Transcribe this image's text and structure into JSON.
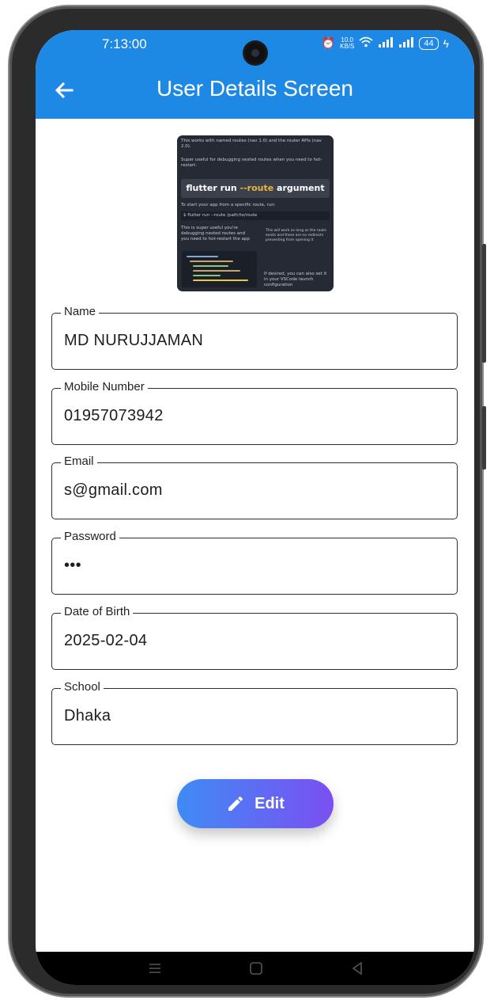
{
  "status_bar": {
    "time": "7:13:00",
    "net_speed_top": "10.0",
    "net_speed_bottom": "KB/S",
    "battery": "44"
  },
  "app_bar": {
    "title": "User Details Screen",
    "back_icon": "arrow-left-icon",
    "color": "#1e88e5"
  },
  "thumbnail": {
    "line1": "This works with named routes (nav 1.0) and the router APIs (nav 2.0).",
    "line2": "Super useful for debugging nested routes when you need to hot-restart.",
    "cmd_prefix": "flutter run ",
    "cmd_highlight": "--route",
    "cmd_suffix": " argument",
    "line3": "To start your app from a specific route, run:",
    "shell": "$ flutter run --route /path/to/route",
    "note_left": "This is super useful you're debugging nested routes and you need to hot-restart the app",
    "note_right": "This will work as long as the route exists and there are no redirects preventing from opening it",
    "note_bottom": "If desired, you can also set it in your VSCode launch configuration"
  },
  "fields": [
    {
      "label": "Name",
      "value": "MD NURUJJAMAN"
    },
    {
      "label": "Mobile Number",
      "value": "01957073942"
    },
    {
      "label": "Email",
      "value": "s@gmail.com"
    },
    {
      "label": "Password",
      "value": "•••"
    },
    {
      "label": "Date of Birth",
      "value": "2025-02-04"
    },
    {
      "label": "School",
      "value": "Dhaka"
    }
  ],
  "edit_button": {
    "label": "Edit",
    "icon": "pencil-icon",
    "gradient_start": "#3f8bf5",
    "gradient_end": "#7b4ff2"
  },
  "nav_bar": {
    "icons": [
      "menu-icon",
      "home-icon",
      "back-triangle-icon"
    ]
  }
}
